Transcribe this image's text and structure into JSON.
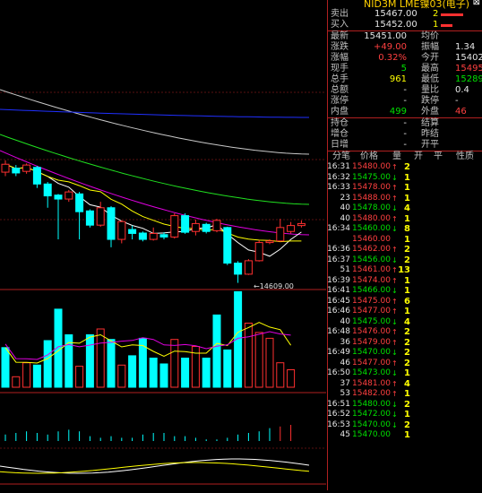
{
  "title": "NID3M LME镍03(电子)",
  "close_icon": "close-icon",
  "queue": [
    {
      "label": "卖出",
      "price": "15467.00",
      "vol": "2",
      "bar": 0.9
    },
    {
      "label": "买入",
      "price": "15452.00",
      "vol": "1",
      "bar": 0.45
    }
  ],
  "stats": [
    {
      "l1": "最新",
      "v1": "15451.00",
      "c1": "wht",
      "l2": "均价",
      "v2": "",
      "c2": "wht"
    },
    {
      "l1": "涨跌",
      "v1": "+49.00",
      "c1": "red",
      "l2": "振幅",
      "v2": "1.34",
      "c2": "wht"
    },
    {
      "l1": "涨幅",
      "v1": "0.32%",
      "c1": "red",
      "l2": "今开",
      "v2": "15402.0",
      "c2": "wht"
    },
    {
      "l1": "现手",
      "v1": "5",
      "c1": "grn",
      "l2": "最高",
      "v2": "15495.0",
      "c2": "red"
    },
    {
      "l1": "总手",
      "v1": "961",
      "c1": "yel",
      "l2": "最低",
      "v2": "15289.0",
      "c2": "grn"
    },
    {
      "l1": "总额",
      "v1": "-",
      "c1": "wht",
      "l2": "量比",
      "v2": "0.4",
      "c2": "wht"
    },
    {
      "l1": "涨停",
      "v1": "-",
      "c1": "wht",
      "l2": "跌停",
      "v2": "-",
      "c2": "wht"
    },
    {
      "l1": "内盘",
      "v1": "499",
      "c1": "grn",
      "l2": "外盘",
      "v2": "46",
      "c2": "red"
    }
  ],
  "stats2": [
    {
      "l1": "持仓",
      "v1": "-",
      "l2": "结算"
    },
    {
      "l1": "增仓",
      "v1": "-",
      "l2": "昨结"
    },
    {
      "l1": "日增",
      "v1": "-",
      "l2": "开平"
    }
  ],
  "tick_headers": [
    "分笔",
    "价格",
    "量",
    "开",
    "平",
    "性质"
  ],
  "ticks": [
    {
      "t": "16:31",
      "p": "15480.00",
      "d": "up",
      "v": "2",
      "c": "red"
    },
    {
      "t": "16:32",
      "p": "15475.00",
      "d": "dn",
      "v": "1",
      "c": "grn"
    },
    {
      "t": "16:33",
      "p": "15478.00",
      "d": "up",
      "v": "1",
      "c": "red"
    },
    {
      "t": "23",
      "p": "15488.00",
      "d": "up",
      "v": "1",
      "c": "red"
    },
    {
      "t": "40",
      "p": "15478.00",
      "d": "dn",
      "v": "4",
      "c": "grn"
    },
    {
      "t": "40",
      "p": "15480.00",
      "d": "up",
      "v": "1",
      "c": "red"
    },
    {
      "t": "16:34",
      "p": "15460.00",
      "d": "dn",
      "v": "8",
      "c": "grn"
    },
    {
      "t": "",
      "p": "15460.00",
      "d": "",
      "v": "1",
      "c": "red"
    },
    {
      "t": "16:36",
      "p": "15462.00",
      "d": "up",
      "v": "2",
      "c": "red"
    },
    {
      "t": "16:37",
      "p": "15456.00",
      "d": "dn",
      "v": "2",
      "c": "grn"
    },
    {
      "t": "51",
      "p": "15461.00",
      "d": "up",
      "v": "13",
      "c": "red"
    },
    {
      "t": "16:39",
      "p": "15474.00",
      "d": "up",
      "v": "1",
      "c": "red"
    },
    {
      "t": "16:41",
      "p": "15466.00",
      "d": "dn",
      "v": "1",
      "c": "grn"
    },
    {
      "t": "16:45",
      "p": "15475.00",
      "d": "up",
      "v": "6",
      "c": "red"
    },
    {
      "t": "16:46",
      "p": "15477.00",
      "d": "up",
      "v": "1",
      "c": "red"
    },
    {
      "t": "40",
      "p": "15475.00",
      "d": "dn",
      "v": "4",
      "c": "grn"
    },
    {
      "t": "16:48",
      "p": "15476.00",
      "d": "up",
      "v": "2",
      "c": "red"
    },
    {
      "t": "36",
      "p": "15479.00",
      "d": "up",
      "v": "2",
      "c": "red"
    },
    {
      "t": "16:49",
      "p": "15470.00",
      "d": "dn",
      "v": "2",
      "c": "grn"
    },
    {
      "t": "46",
      "p": "15477.00",
      "d": "up",
      "v": "2",
      "c": "red"
    },
    {
      "t": "16:50",
      "p": "15473.00",
      "d": "dn",
      "v": "1",
      "c": "grn"
    },
    {
      "t": "37",
      "p": "15481.00",
      "d": "up",
      "v": "4",
      "c": "red"
    },
    {
      "t": "53",
      "p": "15482.00",
      "d": "up",
      "v": "1",
      "c": "red"
    },
    {
      "t": "16:51",
      "p": "15480.00",
      "d": "dn",
      "v": "2",
      "c": "grn"
    },
    {
      "t": "16:52",
      "p": "15472.00",
      "d": "dn",
      "v": "1",
      "c": "grn"
    },
    {
      "t": "16:53",
      "p": "15470.00",
      "d": "dn",
      "v": "2",
      "c": "grn"
    },
    {
      "t": "45",
      "p": "15470.00",
      "d": "",
      "v": "1",
      "c": "grn"
    }
  ],
  "chart_data": {
    "type": "candlestick",
    "low_label": "14609.00",
    "candles": [
      {
        "o": 15470,
        "c": 15490,
        "h": 15500,
        "l": 15460
      },
      {
        "o": 15480,
        "c": 15468,
        "h": 15488,
        "l": 15460
      },
      {
        "o": 15472,
        "c": 15488,
        "h": 15492,
        "l": 15466
      },
      {
        "o": 15482,
        "c": 15440,
        "h": 15486,
        "l": 15430
      },
      {
        "o": 15440,
        "c": 15410,
        "h": 15445,
        "l": 15380
      },
      {
        "o": 15412,
        "c": 15402,
        "h": 15415,
        "l": 15300
      },
      {
        "o": 15402,
        "c": 15420,
        "h": 15425,
        "l": 15395
      },
      {
        "o": 15415,
        "c": 15370,
        "h": 15420,
        "l": 15300
      },
      {
        "o": 15372,
        "c": 15336,
        "h": 15376,
        "l": 15330
      },
      {
        "o": 15336,
        "c": 15380,
        "h": 15395,
        "l": 15332
      },
      {
        "o": 15380,
        "c": 15300,
        "h": 15384,
        "l": 15280
      },
      {
        "o": 15300,
        "c": 15345,
        "h": 15348,
        "l": 15290
      },
      {
        "o": 15325,
        "c": 15315,
        "h": 15335,
        "l": 15300
      },
      {
        "o": 15316,
        "c": 15300,
        "h": 15320,
        "l": 15295
      },
      {
        "o": 15300,
        "c": 15315,
        "h": 15330,
        "l": 15297
      },
      {
        "o": 15312,
        "c": 15306,
        "h": 15318,
        "l": 15300
      },
      {
        "o": 15306,
        "c": 15360,
        "h": 15366,
        "l": 15302
      },
      {
        "o": 15360,
        "c": 15318,
        "h": 15366,
        "l": 15314
      },
      {
        "o": 15320,
        "c": 15340,
        "h": 15350,
        "l": 15310
      },
      {
        "o": 15338,
        "c": 15320,
        "h": 15342,
        "l": 15315
      },
      {
        "o": 15322,
        "c": 15348,
        "h": 15352,
        "l": 15318
      },
      {
        "o": 15330,
        "c": 15240,
        "h": 15332,
        "l": 15235
      },
      {
        "o": 15240,
        "c": 15212,
        "h": 15245,
        "l": 15190
      },
      {
        "o": 15212,
        "c": 15246,
        "h": 15250,
        "l": 15210
      },
      {
        "o": 15246,
        "c": 15292,
        "h": 15298,
        "l": 15244
      },
      {
        "o": 15292,
        "c": 15296,
        "h": 15300,
        "l": 15288
      },
      {
        "o": 15296,
        "c": 15330,
        "h": 15352,
        "l": 15294
      },
      {
        "o": 15320,
        "c": 15335,
        "h": 15344,
        "l": 15315
      },
      {
        "o": 15335,
        "c": 15340,
        "h": 15348,
        "l": 15330
      }
    ],
    "volumes": [
      34,
      9,
      21,
      19,
      40,
      67,
      45,
      18,
      45,
      50,
      41,
      19,
      27,
      42,
      25,
      20,
      41,
      25,
      35,
      25,
      62,
      32,
      82,
      55,
      47,
      42,
      21,
      15
    ],
    "vol_up": [
      false,
      true,
      true,
      false,
      false,
      false,
      false,
      true,
      false,
      true,
      false,
      true,
      false,
      false,
      false,
      false,
      true,
      false,
      true,
      false,
      false,
      false,
      false,
      true,
      true,
      true,
      true,
      true
    ],
    "macd": [
      0.4,
      0.5,
      0.6,
      0.5,
      0.4,
      0.6,
      0.7,
      0.6,
      0.3,
      0.2,
      0.3,
      0.2,
      0.2,
      0.4,
      0.5,
      0.5,
      0.3,
      0.3,
      0.2,
      0.1,
      0.1,
      0.2,
      0.4,
      0.5,
      0.6,
      0.8,
      0.9,
      1.0
    ]
  }
}
